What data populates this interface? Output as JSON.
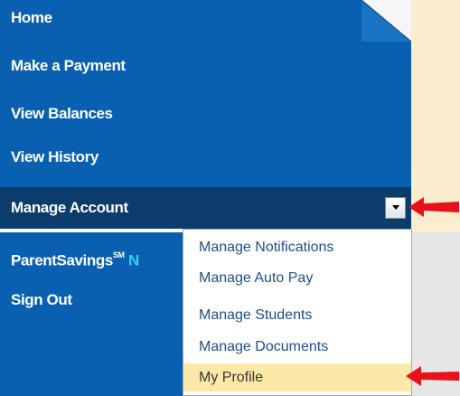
{
  "nav": {
    "items": [
      {
        "label": "Home"
      },
      {
        "label": "Make a Payment"
      },
      {
        "label": "View Balances"
      },
      {
        "label": "View History"
      }
    ],
    "manage_account": {
      "label": "Manage Account",
      "dropdown_icon": "chevron-down-icon"
    },
    "parent_savings": {
      "label": "ParentSavings",
      "superscript": "SM",
      "suffix": "N"
    },
    "sign_out": {
      "label": "Sign Out"
    }
  },
  "dropdown": {
    "items": [
      {
        "label": "Manage Notifications"
      },
      {
        "label": "Manage Auto Pay"
      },
      {
        "label": "Manage Students"
      },
      {
        "label": "Manage Documents"
      },
      {
        "label": "My Profile",
        "highlighted": true
      }
    ]
  },
  "annotations": {
    "arrow_color": "#e8121c",
    "arrow_count": 2
  },
  "colors": {
    "nav_bg": "#0960b0",
    "manage_bar_bg": "#0b3c6b",
    "highlight_bg": "#fde9a7",
    "accent_teal": "#34d2f0",
    "cream": "#fbeecf"
  }
}
